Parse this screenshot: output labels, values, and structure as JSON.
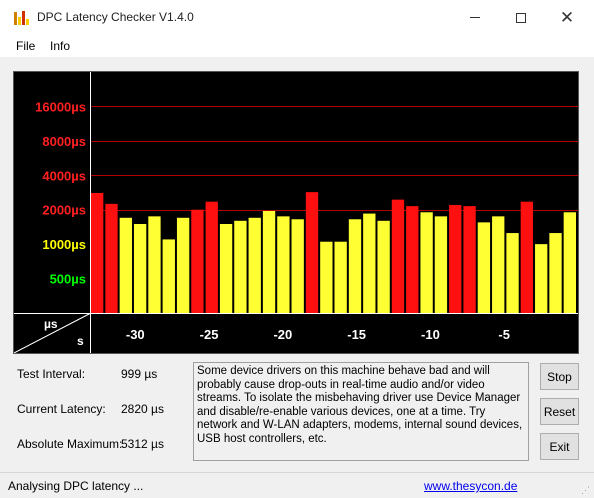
{
  "window": {
    "title": "DPC Latency Checker V1.4.0"
  },
  "menu": {
    "items": [
      "File",
      "Info"
    ]
  },
  "chart_data": {
    "type": "bar",
    "y_tick_labels": [
      "16000µs",
      "8000µs",
      "4000µs",
      "2000µs",
      "1000µs",
      "500µs"
    ],
    "y_tick_colors": [
      "#ff2020",
      "#ff2020",
      "#ff2020",
      "#ff2020",
      "#ffff00",
      "#00ff00"
    ],
    "x_tick_labels": [
      "-30",
      "-25",
      "-20",
      "-15",
      "-10",
      "-5"
    ],
    "corner_labels": {
      "top": "µs",
      "bottom": "s"
    },
    "y_scale": "log",
    "ylim": [
      250,
      32000
    ],
    "bars": [
      {
        "value": 2800,
        "color": "red"
      },
      {
        "value": 2250,
        "color": "red"
      },
      {
        "value": 1700,
        "color": "yellow"
      },
      {
        "value": 1500,
        "color": "yellow"
      },
      {
        "value": 1750,
        "color": "yellow"
      },
      {
        "value": 1100,
        "color": "yellow"
      },
      {
        "value": 1700,
        "color": "yellow"
      },
      {
        "value": 2000,
        "color": "red"
      },
      {
        "value": 2350,
        "color": "red"
      },
      {
        "value": 1500,
        "color": "yellow"
      },
      {
        "value": 1600,
        "color": "yellow"
      },
      {
        "value": 1700,
        "color": "yellow"
      },
      {
        "value": 1950,
        "color": "yellow"
      },
      {
        "value": 1750,
        "color": "yellow"
      },
      {
        "value": 1650,
        "color": "yellow"
      },
      {
        "value": 2850,
        "color": "red"
      },
      {
        "value": 1050,
        "color": "yellow"
      },
      {
        "value": 1050,
        "color": "yellow"
      },
      {
        "value": 1650,
        "color": "yellow"
      },
      {
        "value": 1850,
        "color": "yellow"
      },
      {
        "value": 1600,
        "color": "yellow"
      },
      {
        "value": 2450,
        "color": "red"
      },
      {
        "value": 2150,
        "color": "red"
      },
      {
        "value": 1900,
        "color": "yellow"
      },
      {
        "value": 1750,
        "color": "yellow"
      },
      {
        "value": 2200,
        "color": "red"
      },
      {
        "value": 2150,
        "color": "red"
      },
      {
        "value": 1550,
        "color": "yellow"
      },
      {
        "value": 1750,
        "color": "yellow"
      },
      {
        "value": 1250,
        "color": "yellow"
      },
      {
        "value": 2350,
        "color": "red"
      },
      {
        "value": 1000,
        "color": "yellow"
      },
      {
        "value": 1250,
        "color": "yellow"
      },
      {
        "value": 1900,
        "color": "yellow"
      }
    ],
    "grid_levels": [
      16000,
      8000,
      4000,
      2000
    ],
    "grid": true,
    "colors": {
      "red": "#ff1010",
      "yellow": "#ffff33",
      "grid": "#b00000"
    }
  },
  "stats": {
    "test_interval": {
      "label": "Test Interval:",
      "value": "999 µs"
    },
    "current_latency": {
      "label": "Current Latency:",
      "value": "2820 µs"
    },
    "absolute_maximum": {
      "label": "Absolute Maximum:",
      "value": "5312 µs"
    }
  },
  "description": "Some device drivers on this machine behave bad and will probably cause drop-outs in real-time audio and/or video streams. To isolate the misbehaving driver use Device Manager and disable/re-enable various devices, one at a time. Try network and W-LAN adapters, modems, internal sound devices, USB host controllers, etc.",
  "buttons": {
    "stop": "Stop",
    "reset": "Reset",
    "exit": "Exit"
  },
  "status": {
    "text": "Analysing DPC latency ...",
    "link": "www.thesycon.de"
  }
}
